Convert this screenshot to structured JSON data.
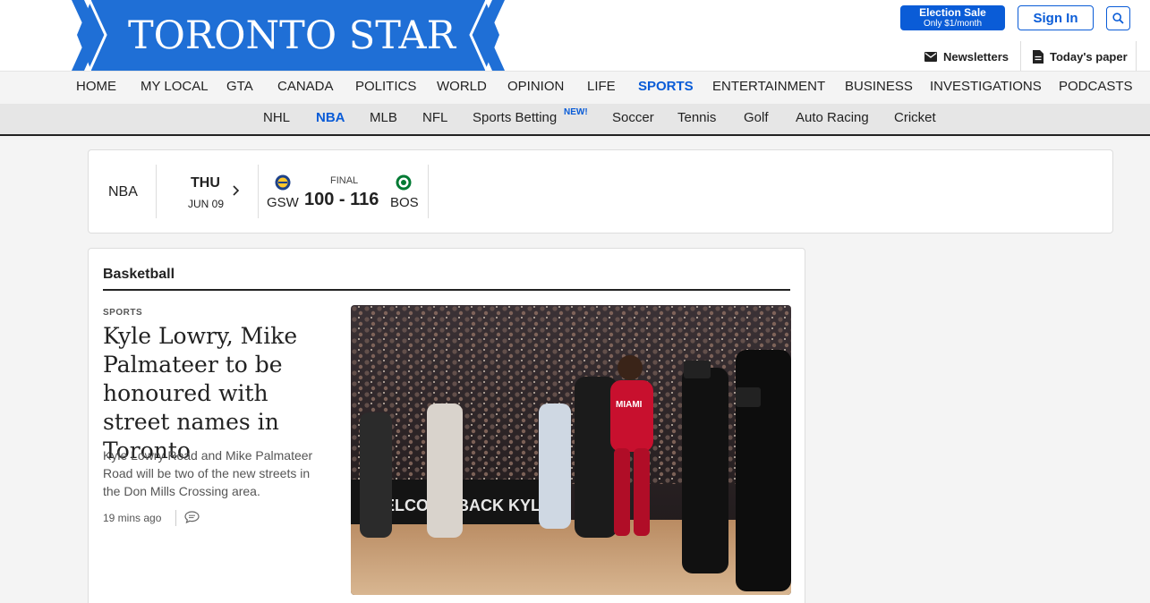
{
  "header": {
    "logo_text": "TORONTO STAR",
    "election_line1": "Election Sale",
    "election_line2": "Only $1/month",
    "signin_label": "Sign In",
    "newsletters_label": "Newsletters",
    "todays_paper_label": "Today's paper"
  },
  "colors": {
    "brand_blue": "#0a5cd7",
    "logo_blue": "#1f6fd6"
  },
  "main_nav": [
    "HOME",
    "MY LOCAL",
    "GTA",
    "CANADA",
    "POLITICS",
    "WORLD",
    "OPINION",
    "LIFE",
    "SPORTS",
    "ENTERTAINMENT",
    "BUSINESS",
    "INVESTIGATIONS",
    "PODCASTS"
  ],
  "sub_nav": [
    "NHL",
    "NBA",
    "MLB",
    "NFL",
    "Sports Betting",
    "Soccer",
    "Tennis",
    "Golf",
    "Auto Racing",
    "Cricket"
  ],
  "sub_nav_new_badge": "NEW!",
  "scoreboard": {
    "league": "NBA",
    "day": "THU",
    "date": "JUN 09",
    "status": "FINAL",
    "away_team": "GSW",
    "home_team": "BOS",
    "score": "100 - 116"
  },
  "article": {
    "section": "Basketball",
    "kicker": "SPORTS",
    "headline": "Kyle Lowry, Mike Palmateer to be honoured with street names in Toronto",
    "dek": "Kyle Lowry Road and Mike Palmateer Road will be two of the new streets in the Don Mills Crossing area.",
    "time": "19 mins ago",
    "photo_banner": "WELCOME BACK KYLE",
    "jersey_text": "MIAMI"
  }
}
